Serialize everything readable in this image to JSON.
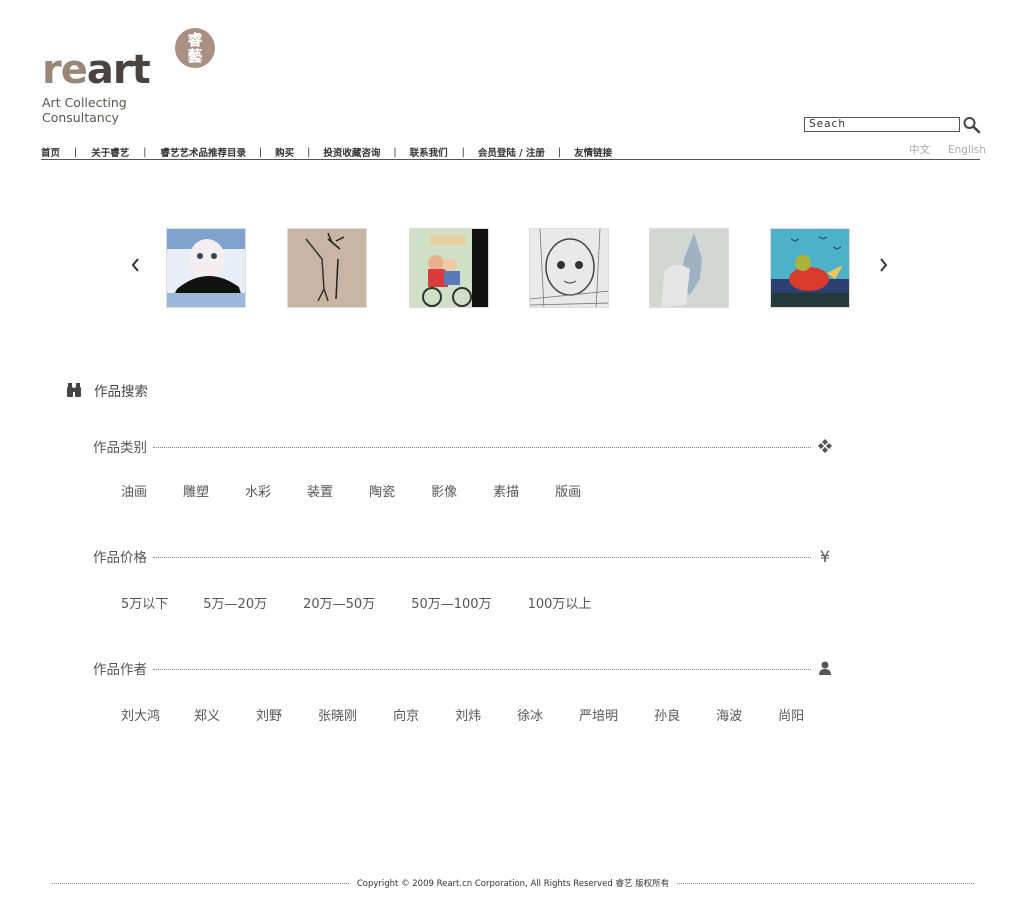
{
  "logo": {
    "word_re": "re",
    "word_art": "art",
    "seal": "睿\n藝",
    "tagline": "Art Collecting\nConsultancy"
  },
  "search": {
    "value": "Seach"
  },
  "nav": {
    "items": [
      "首页",
      "关于睿艺",
      "睿艺艺术品推荐目录",
      "购买",
      "投资收藏咨询",
      "联系我们",
      "会员登陆 / 注册",
      "友情链接"
    ],
    "separator": "|"
  },
  "lang": {
    "zh": "中文",
    "en": "English"
  },
  "carousel": {
    "thumbs": [
      "artwork-1",
      "artwork-2",
      "artwork-3",
      "artwork-4",
      "artwork-5",
      "artwork-6"
    ]
  },
  "search_section": {
    "title": "作品搜索",
    "category": {
      "title": "作品类别",
      "options": [
        "油画",
        "雕塑",
        "水彩",
        "装置",
        "陶瓷",
        "影像",
        "素描",
        "版画"
      ]
    },
    "price": {
      "title": "作品价格",
      "icon": "¥",
      "options": [
        "5万以下",
        "5万—20万",
        "20万—50万",
        "50万—100万",
        "100万以上"
      ]
    },
    "artist": {
      "title": "作品作者",
      "options": [
        "刘大鸿",
        "郑义",
        "刘野",
        "张晓刚",
        "向京",
        "刘炜",
        "徐冰",
        "严培明",
        "孙良",
        "海波",
        "尚阳"
      ]
    }
  },
  "footer": {
    "text": "Copyright © 2009 Reart.cn Corporation, All Rights Reserved 睿艺 版权所有"
  },
  "colors": {
    "brand_light": "#9a8679",
    "brand_dark": "#4a4441",
    "seal": "#a89083"
  }
}
